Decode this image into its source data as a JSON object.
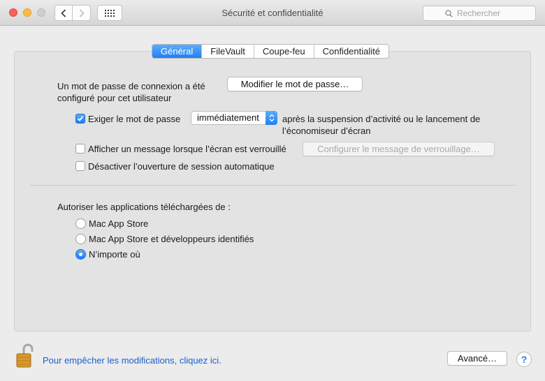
{
  "window": {
    "title": "Sécurité et confidentialité",
    "search_placeholder": "Rechercher"
  },
  "tabs": [
    {
      "label": "Général",
      "active": true
    },
    {
      "label": "FileVault",
      "active": false
    },
    {
      "label": "Coupe-feu",
      "active": false
    },
    {
      "label": "Confidentialité",
      "active": false
    }
  ],
  "general": {
    "password_info_line1": "Un mot de passe de connexion a été",
    "password_info_line2": "configuré pour cet utilisateur",
    "change_password_button": "Modifier le mot de passe…",
    "require_password_label": "Exiger le mot de passe",
    "require_password_checked": true,
    "require_password_delay": "immédiatement",
    "require_password_suffix_line1": "après la suspension d’activité ou le lancement de",
    "require_password_suffix_line2": "l’économiseur d’écran",
    "show_message_label": "Afficher un message lorsque l’écran est verrouillé",
    "show_message_checked": false,
    "configure_message_button": "Configurer le message de verrouillage…",
    "disable_autologin_label": "Désactiver l’ouverture de session automatique",
    "disable_autologin_checked": false,
    "allow_apps_heading": "Autoriser les applications téléchargées de :",
    "allow_apps_options": [
      {
        "label": "Mac App Store",
        "selected": false
      },
      {
        "label": "Mac App Store et développeurs identifiés",
        "selected": false
      },
      {
        "label": "N’importe où",
        "selected": true
      }
    ]
  },
  "footer": {
    "lock_text": "Pour empêcher les modifications, cliquez ici.",
    "advanced_button": "Avancé…",
    "help_button": "?"
  },
  "colors": {
    "accent": "#1f7ff4",
    "link": "#1a5fce"
  },
  "icons": {
    "back": "chevron-left-icon",
    "forward": "chevron-right-icon",
    "grid": "grid-icon",
    "search": "search-icon",
    "lock": "unlocked-padlock-icon"
  }
}
